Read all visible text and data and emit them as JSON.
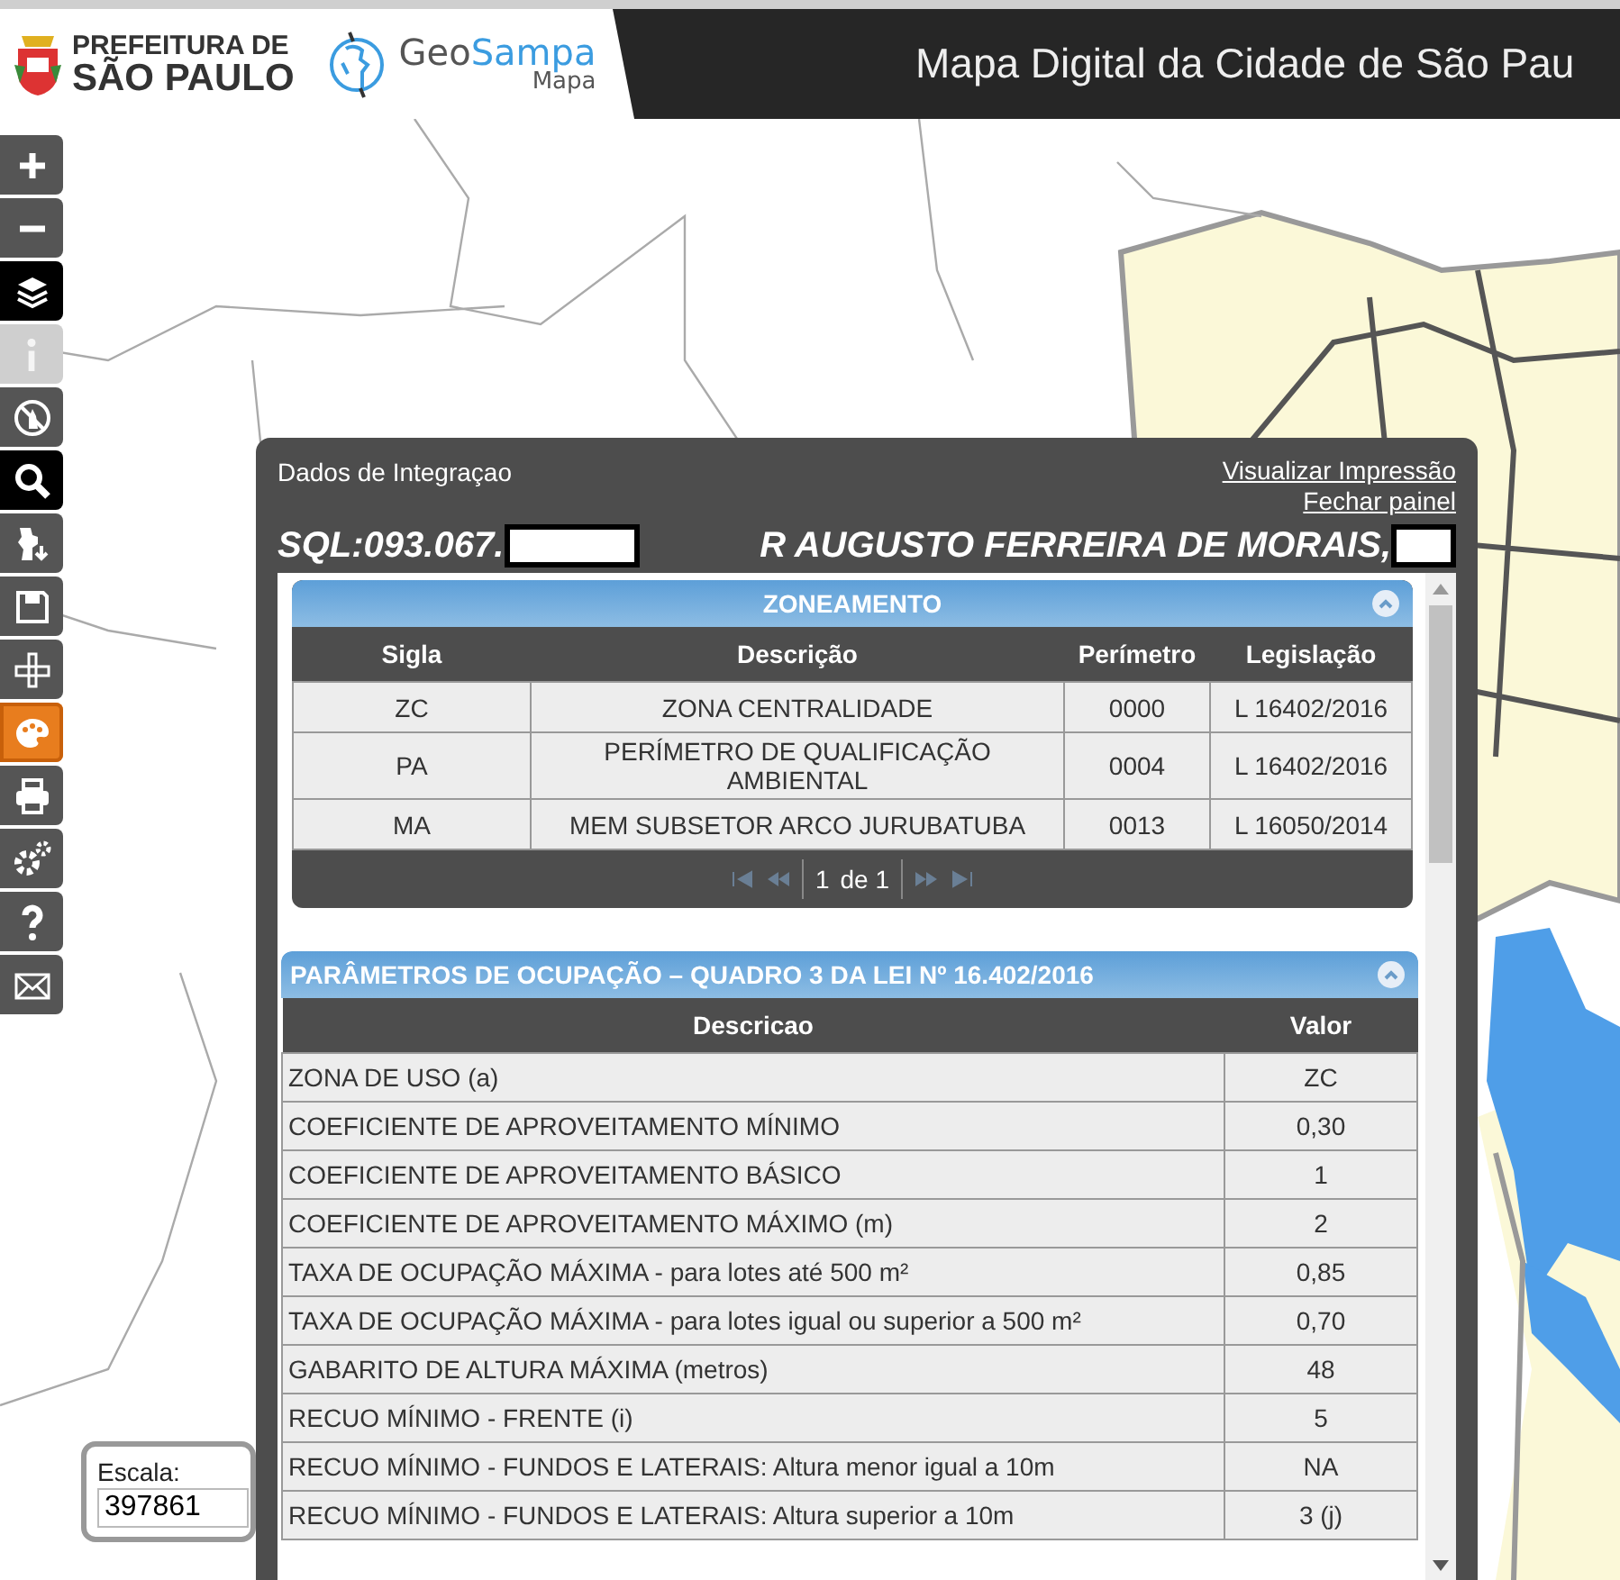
{
  "header": {
    "org_line1": "PREFEITURA DE",
    "org_line2": "SÃO PAULO",
    "brand_prefix": "Geo",
    "brand_suffix": "Sampa",
    "brand_sub": "Mapa",
    "title": "Mapa Digital da Cidade de São Pau"
  },
  "toolbar": [
    {
      "kind": "zoom_in",
      "selected": false,
      "disabled": false,
      "highlighted": false
    },
    {
      "kind": "zoom_out",
      "selected": false,
      "disabled": false,
      "highlighted": false
    },
    {
      "kind": "layers",
      "selected": true,
      "disabled": false,
      "highlighted": false
    },
    {
      "kind": "info",
      "selected": false,
      "disabled": true,
      "highlighted": false
    },
    {
      "kind": "no_touch",
      "selected": false,
      "disabled": false,
      "highlighted": false
    },
    {
      "kind": "search",
      "selected": true,
      "disabled": false,
      "highlighted": false
    },
    {
      "kind": "map_download",
      "selected": false,
      "disabled": false,
      "highlighted": false
    },
    {
      "kind": "save",
      "selected": false,
      "disabled": false,
      "highlighted": false
    },
    {
      "kind": "measure",
      "selected": false,
      "disabled": false,
      "highlighted": false
    },
    {
      "kind": "palette",
      "selected": false,
      "disabled": false,
      "highlighted": true
    },
    {
      "kind": "print",
      "selected": false,
      "disabled": false,
      "highlighted": false
    },
    {
      "kind": "settings",
      "selected": false,
      "disabled": false,
      "highlighted": false
    },
    {
      "kind": "help",
      "selected": false,
      "disabled": false,
      "highlighted": false
    },
    {
      "kind": "mail",
      "selected": false,
      "disabled": false,
      "highlighted": false
    }
  ],
  "scale": {
    "label": "Escala:",
    "value": "397861"
  },
  "panel": {
    "title": "Dados de Integraçao",
    "links": [
      "Visualizar Impressão",
      "Fechar painel"
    ],
    "sql": "SQL:093.067.",
    "address": "R AUGUSTO FERREIRA DE MORAIS,",
    "sections": [
      {
        "kind": "code_table",
        "title": "ZONEAMENTO",
        "expanded": true,
        "columns": [
          "Sigla",
          "Descrição",
          "Perímetro",
          "Legislação"
        ],
        "rows": [
          [
            "ZC",
            "ZONA CENTRALIDADE",
            "0000",
            "L 16402/2016"
          ],
          [
            "PA",
            "PERÍMETRO DE QUALIFICAÇÃO AMBIENTAL",
            "0004",
            "L 16402/2016"
          ],
          [
            "MA",
            "MEM SUBSETOR ARCO JURUBATUBA",
            "0013",
            "L 16050/2014"
          ]
        ],
        "pager": {
          "page": "1",
          "total": "de 1",
          "nav_disabled": true
        }
      },
      {
        "kind": "parameter_table",
        "title": "PARÂMETROS DE OCUPAÇÃO – QUADRO 3 DA LEI Nº 16.402/2016",
        "expanded": true,
        "columns": [
          "Descricao",
          "Valor"
        ],
        "rows": [
          [
            "ZONA DE USO (a)",
            "ZC"
          ],
          [
            "COEFICIENTE DE APROVEITAMENTO MÍNIMO",
            "0,30"
          ],
          [
            "COEFICIENTE DE APROVEITAMENTO BÁSICO",
            "1"
          ],
          [
            "COEFICIENTE DE APROVEITAMENTO MÁXIMO (m)",
            "2"
          ],
          [
            "TAXA DE OCUPAÇÃO MÁXIMA - para lotes até 500 m²",
            "0,85"
          ],
          [
            "TAXA DE OCUPAÇÃO MÁXIMA - para lotes igual ou superior a 500 m²",
            "0,70"
          ],
          [
            "GABARITO DE ALTURA MÁXIMA (metros)",
            "48"
          ],
          [
            "RECUO MÍNIMO - FRENTE (i)",
            "5"
          ],
          [
            "RECUO MÍNIMO - FUNDOS E LATERAIS: Altura menor igual a 10m",
            "NA"
          ],
          [
            "RECUO MÍNIMO - FUNDOS E LATERAIS: Altura superior a 10m",
            "3 (j)"
          ]
        ]
      }
    ]
  }
}
